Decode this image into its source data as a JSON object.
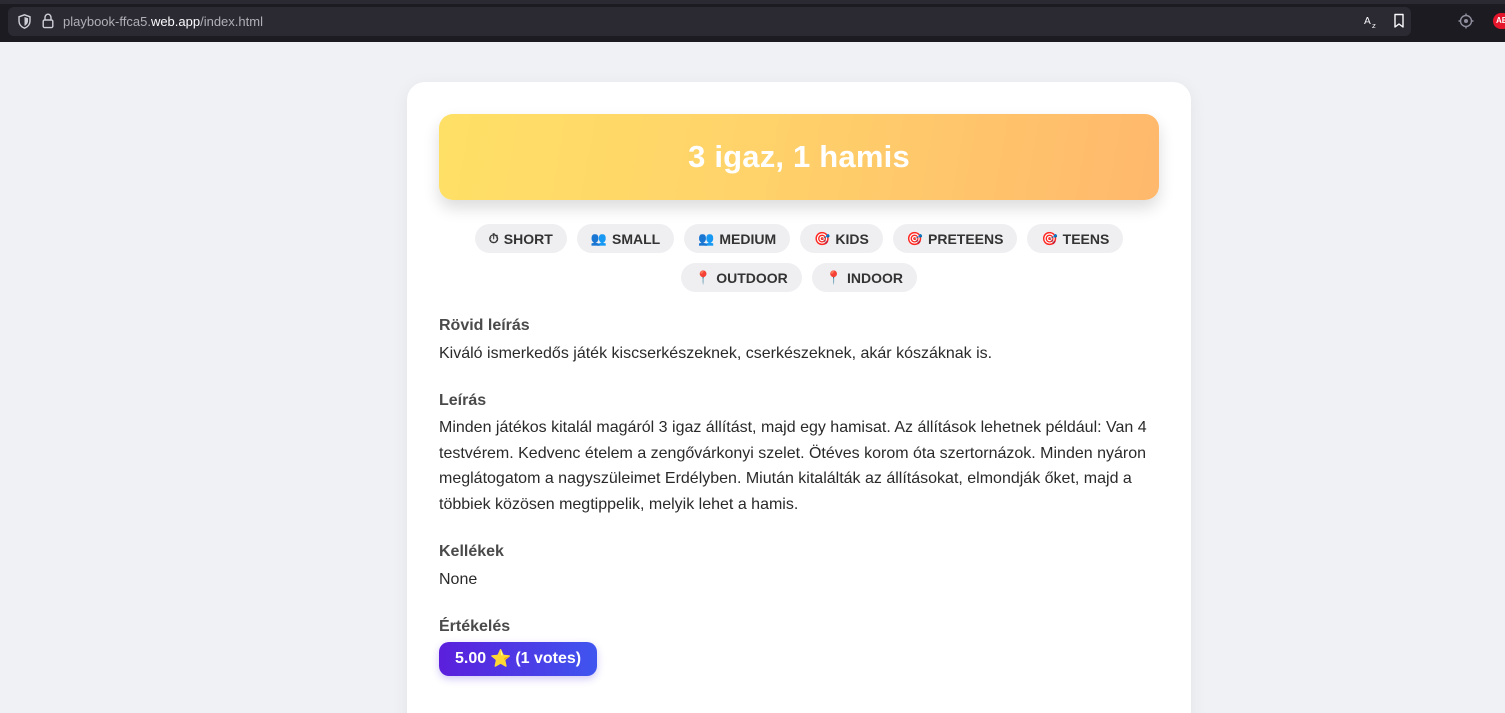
{
  "browser": {
    "url_prefix": "playbook-ffca5.",
    "url_host": "web.app",
    "url_path": "/index.html",
    "extension_badge": "AB"
  },
  "game": {
    "title": "3 igaz, 1 hamis",
    "tags": [
      {
        "icon": "stopwatch-icon",
        "glyph": "⏱",
        "label": "SHORT"
      },
      {
        "icon": "people-icon",
        "glyph": "👥",
        "label": "SMALL"
      },
      {
        "icon": "people-icon",
        "glyph": "👥",
        "label": "MEDIUM"
      },
      {
        "icon": "target-icon",
        "glyph": "🎯",
        "label": "KIDS"
      },
      {
        "icon": "target-icon",
        "glyph": "🎯",
        "label": "PRETEENS"
      },
      {
        "icon": "target-icon",
        "glyph": "🎯",
        "label": "TEENS"
      },
      {
        "icon": "pin-icon",
        "glyph": "📍",
        "label": "OUTDOOR"
      },
      {
        "icon": "pin-icon",
        "glyph": "📍",
        "label": "INDOOR"
      }
    ],
    "short_description_title": "Rövid leírás",
    "short_description": "Kiváló ismerkedős játék kiscserkészeknek, cserkészeknek, akár kószáknak is.",
    "description_title": "Leírás",
    "description": "Minden játékos kitalál magáról 3 igaz állítást, majd egy hamisat. Az állítások lehetnek például: Van 4 testvérem. Kedvenc ételem a zengővárkonyi szelet. Ötéves korom óta szertornázok. Minden nyáron meglátogatom a nagyszüleimet Erdélyben. Miután kitalálták az állításokat, elmondják őket, majd a többiek közösen megtippelik, melyik lehet a hamis.",
    "equipment_title": "Kellékek",
    "equipment": "None",
    "rating_title": "Értékelés",
    "rating_score": "5.00",
    "rating_star": "⭐",
    "rating_votes": "(1 votes)"
  },
  "colors": {
    "banner_start": "#ffe066",
    "banner_end": "#ffb86c",
    "rating_start": "#5b1fdc",
    "rating_end": "#3f55ef"
  }
}
